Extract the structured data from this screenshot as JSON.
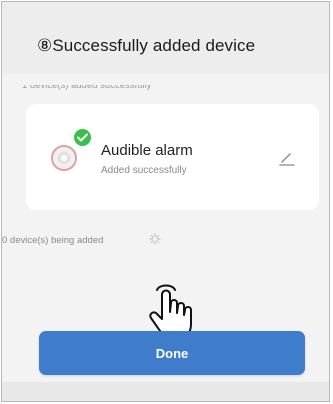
{
  "caption": "⑧Successfully added device",
  "success_count": "1 device(s) added successfully",
  "device": {
    "name": "Audible alarm",
    "status": "Added successfully",
    "icon": "alarm-device-icon",
    "badge": "check-icon",
    "edit_icon": "pencil-icon"
  },
  "adding_status": "0 device(s) being added",
  "done_label": "Done",
  "colors": {
    "accent": "#3f7ccb",
    "success": "#3bbf4b"
  }
}
